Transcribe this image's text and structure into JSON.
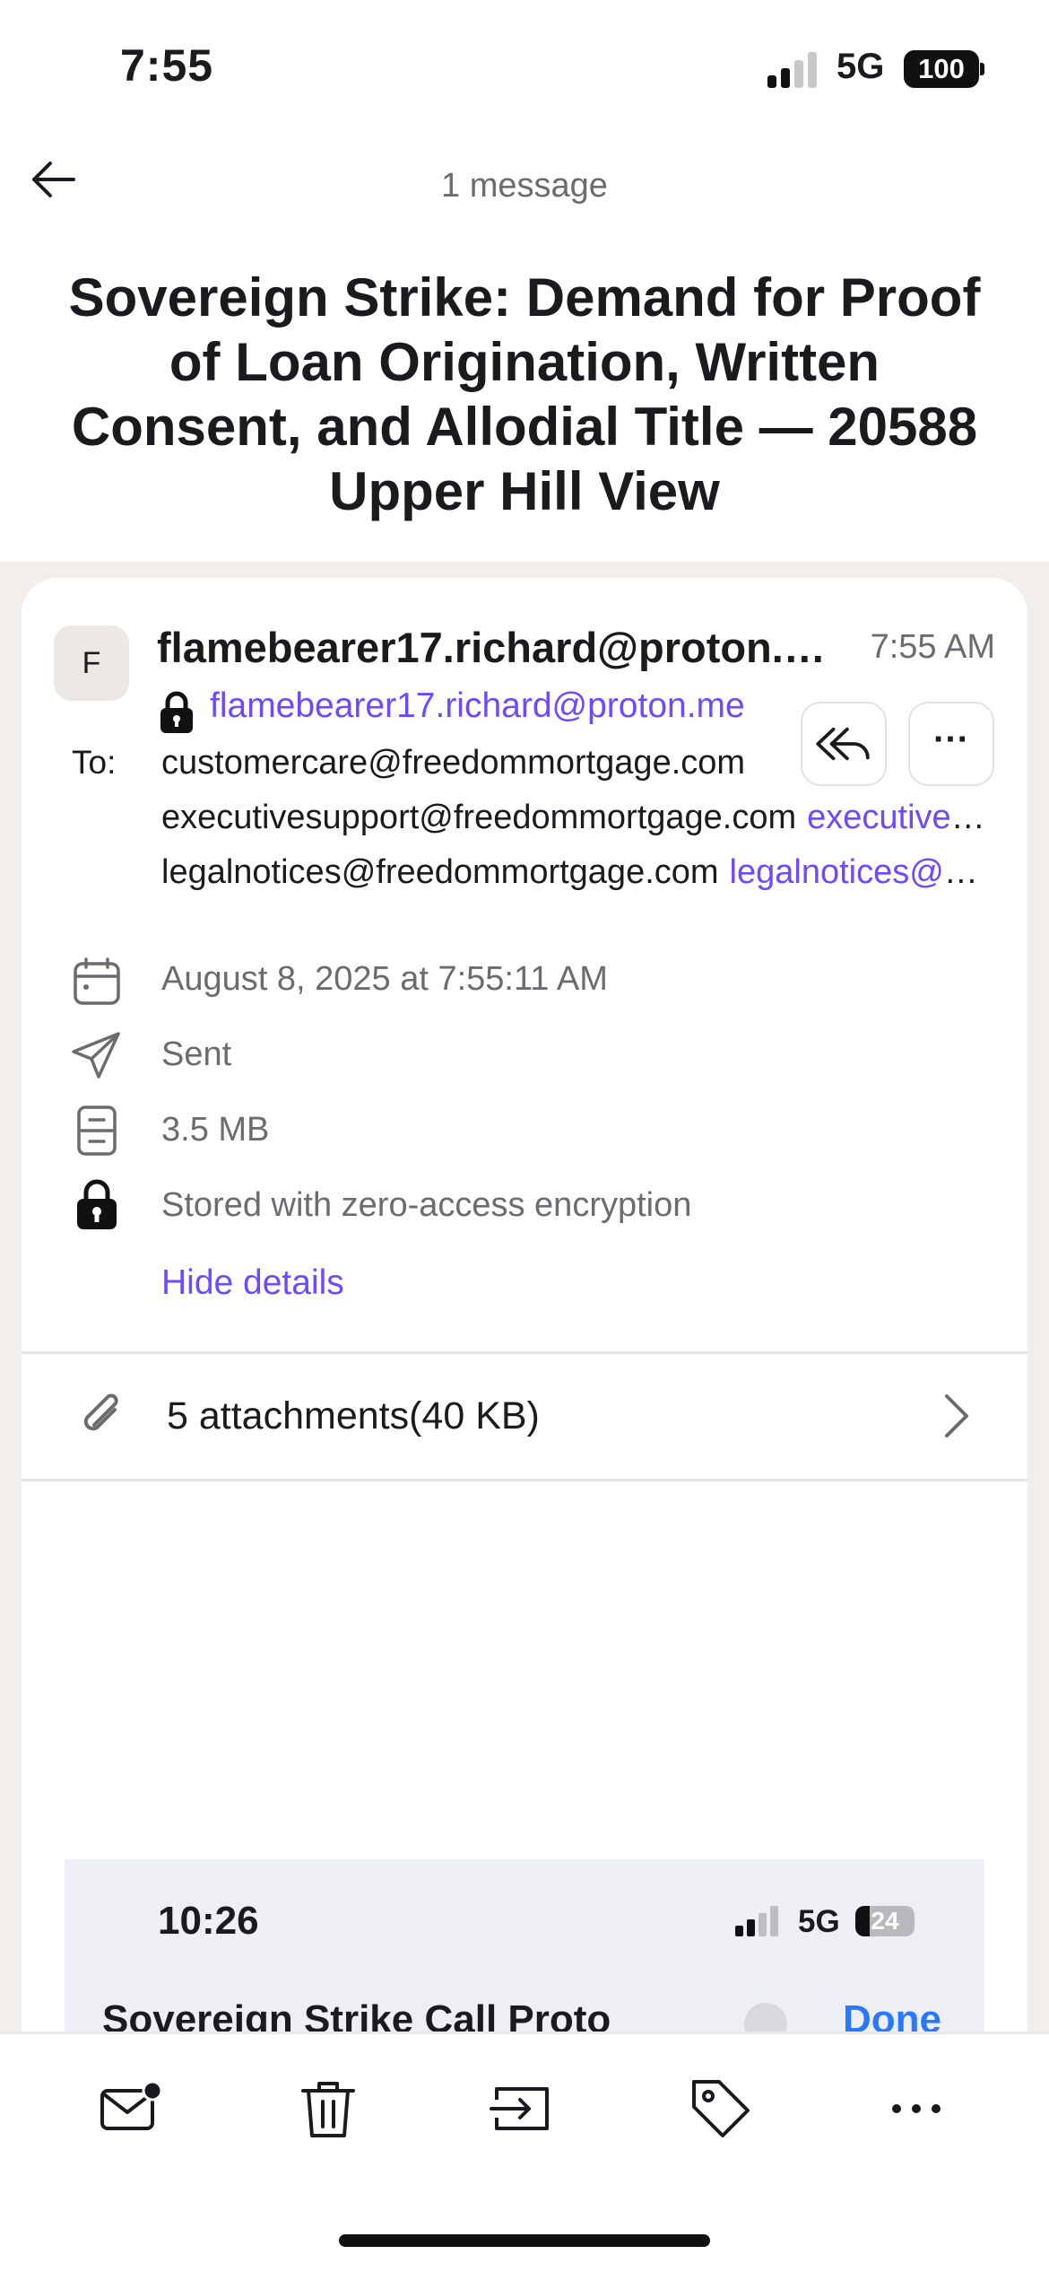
{
  "status_bar": {
    "time": "7:55",
    "network": "5G",
    "battery": "100"
  },
  "header": {
    "message_count": "1 message",
    "back_icon": "arrow-left-icon"
  },
  "email": {
    "subject": "Sovereign Strike: Demand for Proof of Loan Origination, Written Consent, and Allodial Title — 20588 Upper Hill View",
    "avatar_initial": "F",
    "sender_name": "flamebearer17.richard@proton.me",
    "sender_address": "flamebearer17.richard@proton.me",
    "sent_time": "7:55 AM",
    "to_label": "To:",
    "recipients": [
      {
        "address": "customercare@freedommortgage.com",
        "alias": ""
      },
      {
        "address": "executivesupport@freedommortgage.com",
        "alias": "executivesupport@freedommortgage.com"
      },
      {
        "address": "legalnotices@freedommortgage.com",
        "alias": "legalnotices@freedommortgage.com"
      }
    ],
    "details": {
      "date": "August 8, 2025 at 7:55:11 AM",
      "status": "Sent",
      "size": "3.5 MB",
      "encryption": "Stored with zero-access encryption",
      "hide_label": "Hide details"
    },
    "attachments_label": "5 attachments(40 KB)"
  },
  "embedded_screenshot": {
    "time": "10:26",
    "network": "5G",
    "battery": "24",
    "title": "Sovereign Strike Call Proto",
    "done_label": "Done"
  },
  "toolbar": {
    "icons": [
      "mark-unread-icon",
      "trash-icon",
      "move-to-folder-icon",
      "label-tag-icon",
      "more-icon"
    ]
  },
  "colors": {
    "accent": "#6d4aff",
    "background_gray": "#f1eeeb",
    "ios_blue": "#2979ff"
  }
}
